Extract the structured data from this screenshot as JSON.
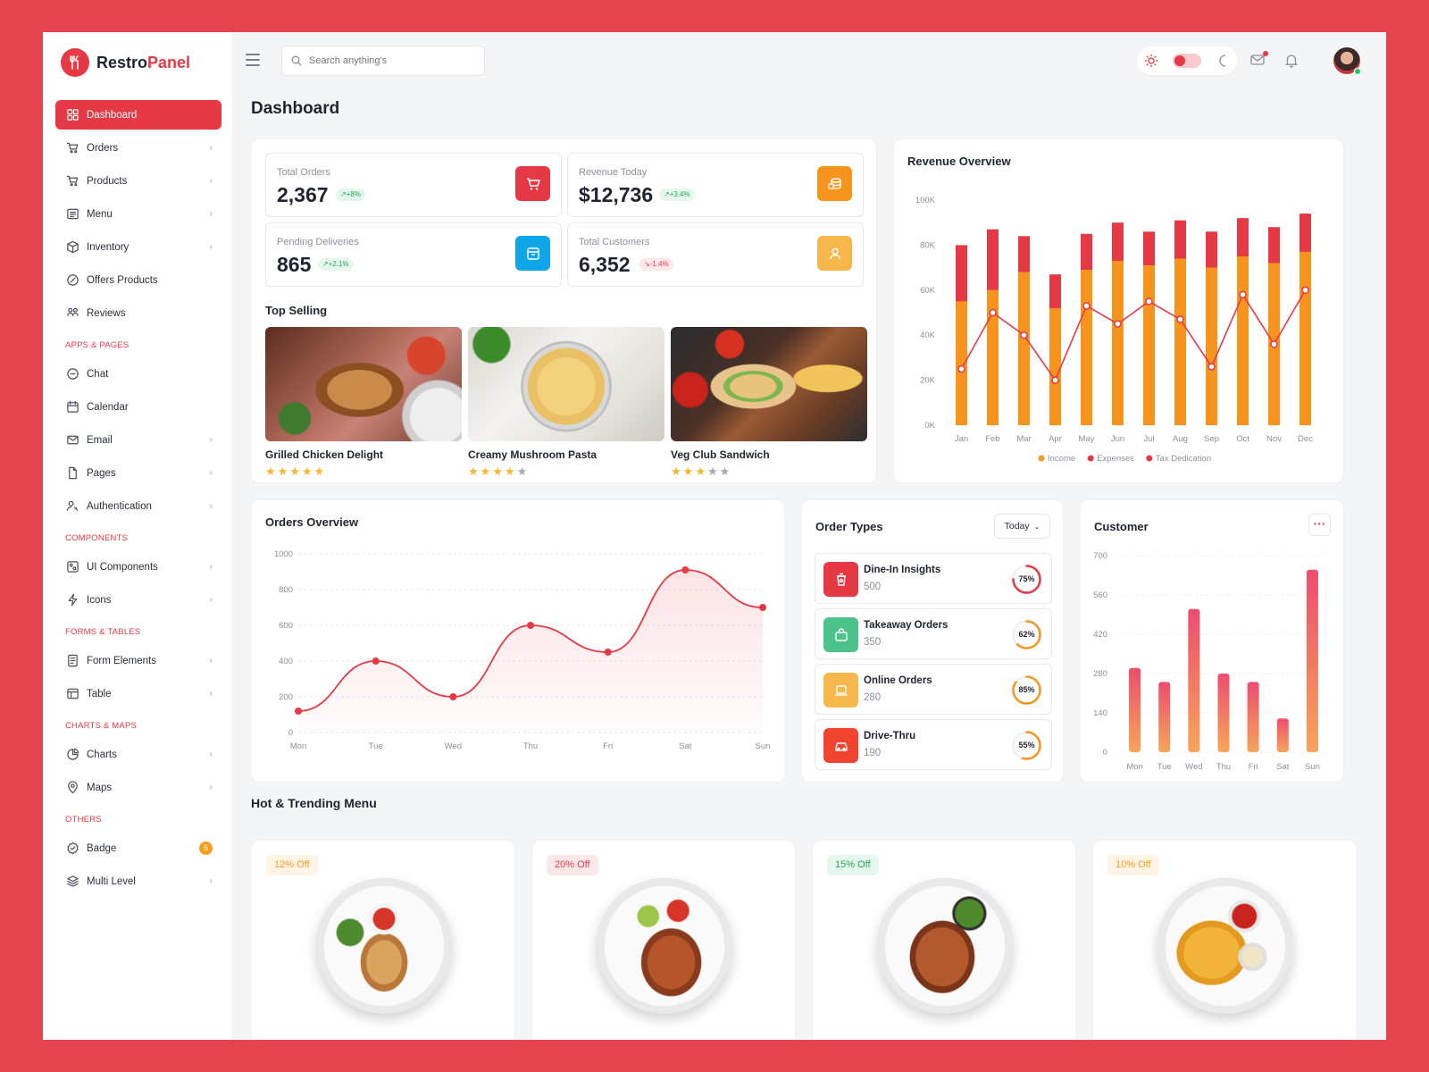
{
  "app": {
    "brand_first": "Restro",
    "brand_second": "Panel",
    "accent": "#e53945"
  },
  "search": {
    "placeholder": "Search anything's"
  },
  "nav": {
    "main": [
      {
        "label": "Dashboard",
        "icon": "dashboard-icon",
        "active": true
      },
      {
        "label": "Orders",
        "icon": "cart-icon",
        "chevron": true
      },
      {
        "label": "Products",
        "icon": "cart-icon",
        "chevron": true
      },
      {
        "label": "Menu",
        "icon": "list-icon",
        "chevron": true
      },
      {
        "label": "Inventory",
        "icon": "box-icon",
        "chevron": true
      },
      {
        "label": "Offers Products",
        "icon": "discount-icon"
      },
      {
        "label": "Reviews",
        "icon": "reviews-icon"
      }
    ],
    "apps_title": "APPS & PAGES",
    "apps": [
      {
        "label": "Chat",
        "icon": "chat-icon"
      },
      {
        "label": "Calendar",
        "icon": "calendar-icon"
      },
      {
        "label": "Email",
        "icon": "mail-icon",
        "chevron": true
      },
      {
        "label": "Pages",
        "icon": "file-icon",
        "chevron": true
      },
      {
        "label": "Authentication",
        "icon": "user-key-icon",
        "chevron": true
      }
    ],
    "components_title": "COMPONENTS",
    "components": [
      {
        "label": "UI Components",
        "icon": "components-icon",
        "chevron": true
      },
      {
        "label": "Icons",
        "icon": "bolt-icon",
        "chevron": true
      }
    ],
    "forms_title": "FORMS & TABLES",
    "forms": [
      {
        "label": "Form Elements",
        "icon": "form-icon",
        "chevron": true
      },
      {
        "label": "Table",
        "icon": "table-icon",
        "chevron": true
      }
    ],
    "charts_title": "CHARTS & MAPS",
    "charts": [
      {
        "label": "Charts",
        "icon": "pie-icon",
        "chevron": true
      },
      {
        "label": "Maps",
        "icon": "pin-icon",
        "chevron": true
      }
    ],
    "others_title": "OTHERS",
    "others": [
      {
        "label": "Badge",
        "icon": "badge-icon",
        "badge": "5"
      },
      {
        "label": "Multi Level",
        "icon": "layers-icon",
        "chevron": true
      }
    ]
  },
  "page": {
    "title": "Dashboard"
  },
  "stats": [
    {
      "label": "Total Orders",
      "value": "2,367",
      "change": "+8%",
      "trend": "up",
      "color": "#e53945",
      "icon": "cart-icon"
    },
    {
      "label": "Revenue Today",
      "value": "$12,736",
      "change": "+3.4%",
      "trend": "up",
      "color": "#f59e1b",
      "icon": "coins-icon"
    },
    {
      "label": "Pending Deliveries",
      "value": "865",
      "change": "+2.1%",
      "trend": "up",
      "color": "#0ea5e9",
      "icon": "archive-icon"
    },
    {
      "label": "Total Customers",
      "value": "6,352",
      "change": "-1.4%",
      "trend": "down",
      "color": "#f7b84b",
      "icon": "user-icon"
    }
  ],
  "top_selling": {
    "title": "Top Selling",
    "items": [
      {
        "name": "Grilled Chicken Delight",
        "rating": 5
      },
      {
        "name": "Creamy Mushroom Pasta",
        "rating": 4
      },
      {
        "name": "Veg Club Sandwich",
        "rating": 3
      }
    ]
  },
  "revenue": {
    "title": "Revenue Overview"
  },
  "orders_overview": {
    "title": "Orders Overview"
  },
  "order_types": {
    "title": "Order Types",
    "filter": "Today",
    "items": [
      {
        "name": "Dine-In Insights",
        "count": "500",
        "percent": 75,
        "percent_label": "75%",
        "color": "#e53945",
        "icon": "cup-icon"
      },
      {
        "name": "Takeaway Orders",
        "count": "350",
        "percent": 62,
        "percent_label": "62%",
        "color": "#4cc38a",
        "icon": "bag-icon"
      },
      {
        "name": "Online Orders",
        "count": "280",
        "percent": 85,
        "percent_label": "85%",
        "color": "#f7b84b",
        "icon": "laptop-icon"
      },
      {
        "name": "Drive-Thru",
        "count": "190",
        "percent": 55,
        "percent_label": "55%",
        "color": "#f0442e",
        "icon": "car-icon"
      }
    ]
  },
  "customer": {
    "title": "Customer",
    "more": "···"
  },
  "hot_menu": {
    "title": "Hot & Trending Menu",
    "items": [
      {
        "badge": "12% Off",
        "badge_color": "#f59e1b",
        "badge_bg": "#fff4e5"
      },
      {
        "badge": "20% Off",
        "badge_color": "#e53945",
        "badge_bg": "#fde8e9"
      },
      {
        "badge": "15% Off",
        "badge_color": "#22a45d",
        "badge_bg": "#e6f7ed"
      },
      {
        "badge": "10% Off",
        "badge_color": "#f59e1b",
        "badge_bg": "#fff4e5"
      }
    ]
  },
  "chart_data": [
    {
      "type": "bar",
      "title": "Revenue Overview",
      "stacked": true,
      "categories": [
        "Jan",
        "Feb",
        "Mar",
        "Apr",
        "May",
        "Jun",
        "Jul",
        "Aug",
        "Sep",
        "Oct",
        "Nov",
        "Dec"
      ],
      "series": [
        {
          "name": "Income",
          "type": "bar",
          "color": "#f7941e",
          "values": [
            55,
            60,
            68,
            52,
            69,
            73,
            71,
            74,
            70,
            75,
            72,
            77
          ]
        },
        {
          "name": "Expenses",
          "type": "bar",
          "color": "#e53945",
          "values": [
            25,
            27,
            16,
            15,
            16,
            17,
            15,
            17,
            16,
            17,
            16,
            17
          ]
        },
        {
          "name": "Tax Dedication",
          "type": "line",
          "color": "#e53945",
          "values": [
            25,
            50,
            40,
            20,
            53,
            45,
            55,
            47,
            26,
            58,
            36,
            60
          ]
        }
      ],
      "ylim": [
        0,
        100
      ],
      "yticks": [
        "0K",
        "20K",
        "40K",
        "60K",
        "80K",
        "100K"
      ],
      "legend": "bottom",
      "grid": false
    },
    {
      "type": "area",
      "title": "Orders Overview",
      "categories": [
        "Mon",
        "Tue",
        "Wed",
        "Thu",
        "Fri",
        "Sat",
        "Sun"
      ],
      "series": [
        {
          "values": [
            120,
            400,
            200,
            600,
            450,
            910,
            700
          ],
          "color": "#e53945"
        }
      ],
      "ylim": [
        0,
        1000
      ],
      "yticks": [
        "0",
        "200",
        "400",
        "600",
        "800",
        "1000"
      ],
      "grid": true
    },
    {
      "type": "bar",
      "title": "Customer",
      "categories": [
        "Mon",
        "Tue",
        "Wed",
        "Thu",
        "Fri",
        "Sat",
        "Sun"
      ],
      "series": [
        {
          "values": [
            300,
            250,
            510,
            280,
            250,
            120,
            650
          ],
          "color_top": "#ed4d6e",
          "color_bottom": "#f7a55a"
        }
      ],
      "ylim": [
        0,
        700
      ],
      "yticks": [
        "0",
        "140",
        "280",
        "420",
        "560",
        "700"
      ],
      "grid": true
    }
  ]
}
